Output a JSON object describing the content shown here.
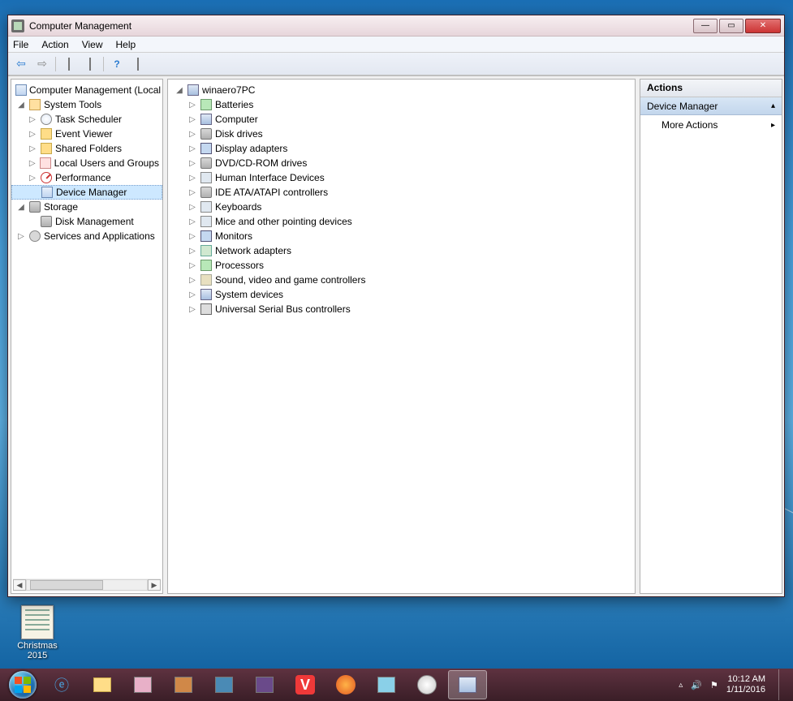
{
  "desktop": {
    "icon_label_1": "Christmas",
    "icon_label_2": "2015"
  },
  "taskbar": {
    "time": "10:12 AM",
    "date": "1/11/2016"
  },
  "window": {
    "title": "Computer Management",
    "menu": [
      "File",
      "Action",
      "View",
      "Help"
    ],
    "left_tree": {
      "root": "Computer Management (Local",
      "system_tools": {
        "label": "System Tools",
        "children": [
          {
            "label": "Task Scheduler",
            "icon": "ic-clock"
          },
          {
            "label": "Event Viewer",
            "icon": "ic-folder"
          },
          {
            "label": "Shared Folders",
            "icon": "ic-folder"
          },
          {
            "label": "Local Users and Groups",
            "icon": "ic-user"
          },
          {
            "label": "Performance",
            "icon": "ic-perf"
          },
          {
            "label": "Device Manager",
            "icon": "ic-dm",
            "selected": true
          }
        ]
      },
      "storage": {
        "label": "Storage",
        "children": [
          {
            "label": "Disk Management",
            "icon": "ic-disk"
          }
        ]
      },
      "services": {
        "label": "Services and Applications",
        "icon": "ic-gear"
      }
    },
    "center_tree": {
      "root": "winaero7PC",
      "items": [
        {
          "label": "Batteries",
          "icon": "ic-chip"
        },
        {
          "label": "Computer",
          "icon": "ic-pc"
        },
        {
          "label": "Disk drives",
          "icon": "ic-disk"
        },
        {
          "label": "Display adapters",
          "icon": "ic-mon"
        },
        {
          "label": "DVD/CD-ROM drives",
          "icon": "ic-disk"
        },
        {
          "label": "Human Interface Devices",
          "icon": "ic-kb"
        },
        {
          "label": "IDE ATA/ATAPI controllers",
          "icon": "ic-disk"
        },
        {
          "label": "Keyboards",
          "icon": "ic-kb"
        },
        {
          "label": "Mice and other pointing devices",
          "icon": "ic-kb"
        },
        {
          "label": "Monitors",
          "icon": "ic-mon"
        },
        {
          "label": "Network adapters",
          "icon": "ic-net"
        },
        {
          "label": "Processors",
          "icon": "ic-chip"
        },
        {
          "label": "Sound, video and game controllers",
          "icon": "ic-snd"
        },
        {
          "label": "System devices",
          "icon": "ic-pc"
        },
        {
          "label": "Universal Serial Bus controllers",
          "icon": "ic-usb"
        }
      ]
    },
    "actions": {
      "header": "Actions",
      "section": "Device Manager",
      "item1": "More Actions"
    }
  }
}
